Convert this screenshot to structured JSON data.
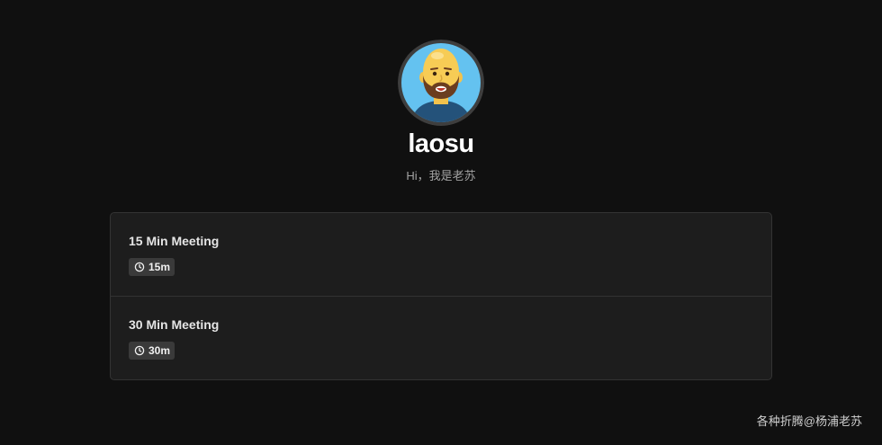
{
  "profile": {
    "name": "laosu",
    "bio": "Hi，我是老苏",
    "avatar_icon": "bald-bearded-man-avatar"
  },
  "events": [
    {
      "title": "15 Min Meeting",
      "duration": "15m",
      "icon": "clock-icon"
    },
    {
      "title": "30 Min Meeting",
      "duration": "30m",
      "icon": "clock-icon"
    }
  ],
  "watermark": "各种折腾@杨浦老苏",
  "colors": {
    "background": "#101010",
    "card": "#1d1d1d",
    "border": "#333333",
    "badge": "#3a3a3a",
    "avatar_bg": "#64c2f0",
    "avatar_ring": "#3e3e3e"
  }
}
